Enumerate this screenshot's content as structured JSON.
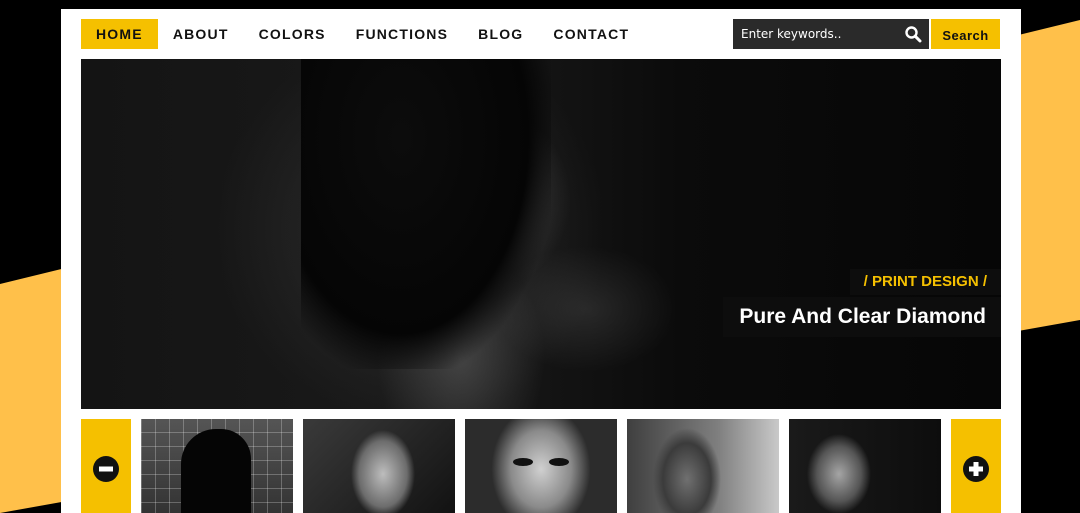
{
  "nav": {
    "items": [
      {
        "label": "HOME",
        "active": true
      },
      {
        "label": "ABOUT",
        "active": false
      },
      {
        "label": "COLORS",
        "active": false
      },
      {
        "label": "FUNCTIONS",
        "active": false
      },
      {
        "label": "BLOG",
        "active": false
      },
      {
        "label": "CONTACT",
        "active": false
      }
    ]
  },
  "search": {
    "placeholder": "Enter keywords..",
    "button_label": "Search",
    "icon": "search-icon"
  },
  "slider": {
    "category": "/ PRINT DESIGN /",
    "title": "Pure And Clear Diamond"
  },
  "thumbnails": {
    "prev_icon": "minus-circle-icon",
    "next_icon": "plus-circle-icon",
    "count": 5
  },
  "colors": {
    "accent": "#f5c000",
    "background": "#000000",
    "stripe": "#ffc04a",
    "panel": "#ffffff"
  }
}
